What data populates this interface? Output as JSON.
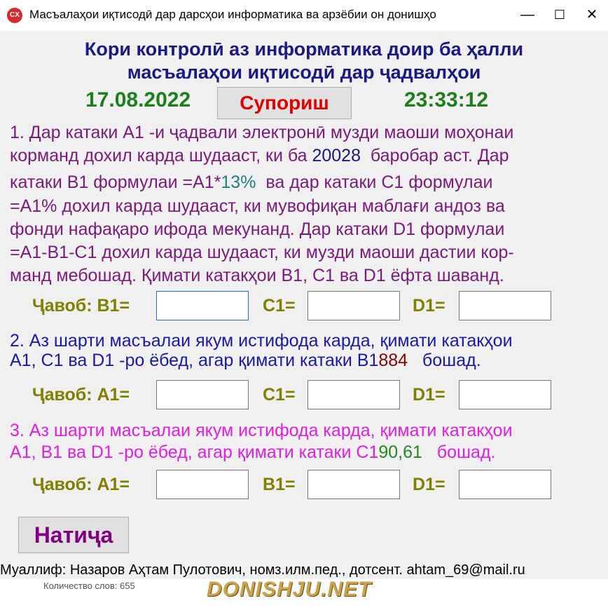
{
  "window": {
    "title": "Масъалаҳои иқтисодӣ дар дарсҳои информатика ва арзёбии он донишҳо",
    "icon_text": "CX",
    "minimize": "—",
    "maximize": "☐",
    "close": "✕"
  },
  "header": {
    "line1": "Кори контролӣ аз информатика доир ба ҳалли",
    "line2": "масъалаҳои иқтисодӣ дар ҷадвалҳои",
    "date": "17.08.2022",
    "task_button": "Супориш",
    "time": "23:33:12"
  },
  "q1": {
    "lines": [
      "1. Дар катаки A1 -и ҷадвали электронӣ музди маоши моҳонаи",
      "корманд дохил карда шудааст, ки ба",
      "баробар аст. Дар",
      "катаки B1 формулаи =A1*",
      "ва  дар  катаки  C1  формулаи",
      "=A1% дохил карда шудааст, ки мувофиқан маблағи андоз  ва",
      "фонди нафақаро ифода мекунанд. Дар  катаки  D1  формулаи",
      "=A1-B1-C1 дохил карда шудааст, ки музди маоши дастии кор-",
      "манд мебошад. Қимати катакҳои B1, C1 ва D1 ёфта шаванд."
    ],
    "value": "20028",
    "percent": "13%",
    "answer_label": "Ҷавоб: B1=",
    "c1_label": "C1=",
    "d1_label": "D1="
  },
  "q2": {
    "line1": "2. Аз шарти масъалаи якум истифода карда, қимати катакҳои",
    "line2": "A1, C1 ва D1 -ро ёбед, агар қимати катаки B1",
    "value": "884",
    "line2_end": "бошад.",
    "answer_label": "Ҷавоб: A1=",
    "c1_label": "C1=",
    "d1_label": "D1="
  },
  "q3": {
    "line1": "3. Аз шарти масъалаи якум истифода карда, қимати катакҳои",
    "line2": "A1, B1 ва D1 -ро ёбед, агар қимати катаки C1",
    "value": "90,61",
    "line2_end": "бошад.",
    "answer_label": "Ҷавоб: A1=",
    "b1_label": "B1=",
    "d1_label": "D1="
  },
  "result_button": "Натиҷа",
  "author": "Муаллиф: Назаров Аҳтам Пулотович, номз.илм.пед., дотсент.  ahtam_69@mail.ru",
  "status": {
    "word_count": "Количество слов: 655",
    "watermark": "DONISHJU.NET"
  },
  "colors": {
    "heading": "#1a1a80",
    "date_time": "#1e7e1e",
    "task_button_text": "#e00000",
    "q1_text": "#7a1a7a",
    "q2_text": "#1a1aa8",
    "q3_text": "#e020e0",
    "answer_labels": "#808000",
    "result_button_text": "#800080"
  }
}
